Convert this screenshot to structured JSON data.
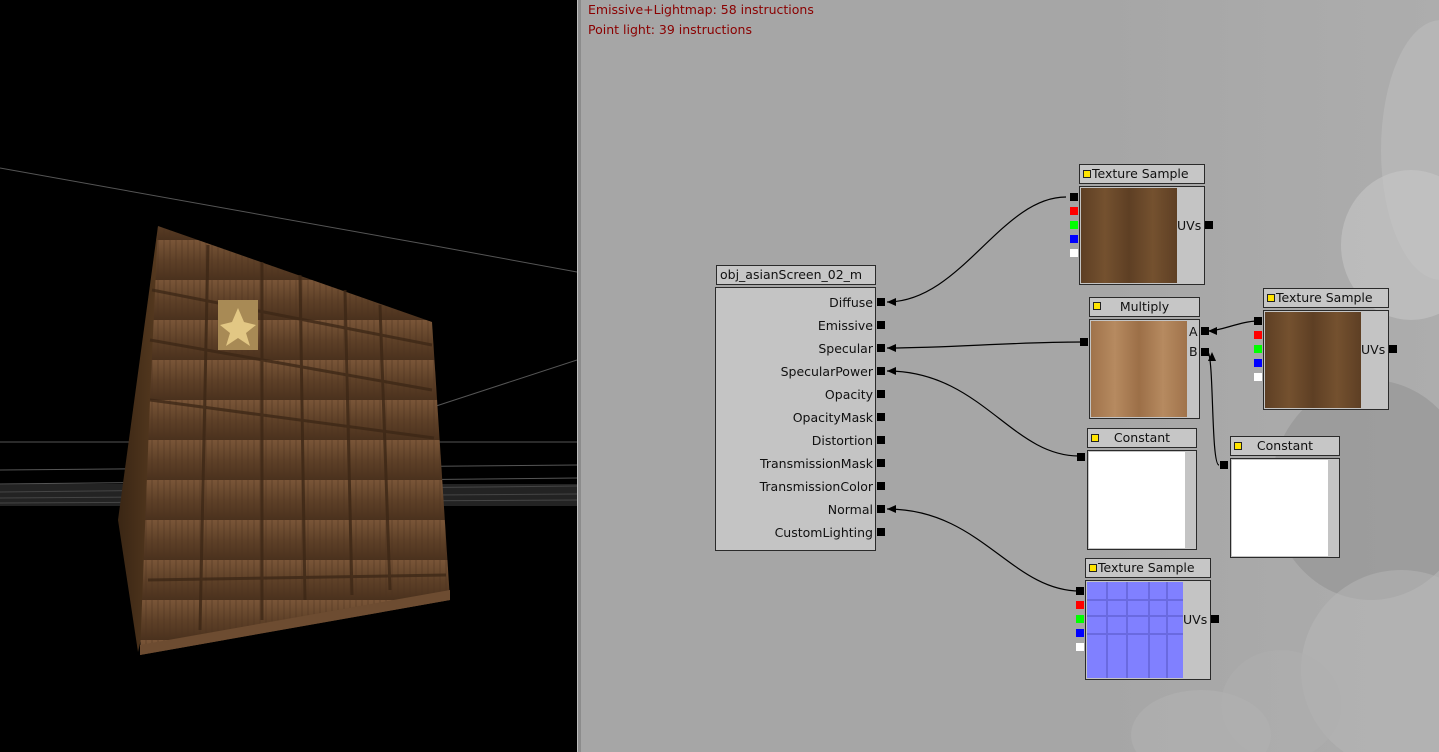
{
  "stats": {
    "line1": "Emissive+Lightmap: 58 instructions",
    "line2": "Point light: 39 instructions"
  },
  "material_node": {
    "title": "obj_asianScreen_02_m",
    "inputs": [
      "Diffuse",
      "Emissive",
      "Specular",
      "SpecularPower",
      "Opacity",
      "OpacityMask",
      "Distortion",
      "TransmissionMask",
      "TransmissionColor",
      "Normal",
      "CustomLighting"
    ]
  },
  "nodes": {
    "tex_diffuse": {
      "title": "Texture Sample",
      "uv_label": "UVs"
    },
    "multiply": {
      "title": "Multiply",
      "input_a": "A",
      "input_b": "B"
    },
    "tex_spec": {
      "title": "Texture Sample",
      "uv_label": "UVs"
    },
    "constant_1": {
      "title": "Constant"
    },
    "constant_2": {
      "title": "Constant"
    },
    "tex_normal": {
      "title": "Texture Sample",
      "uv_label": "UVs"
    }
  },
  "channel_colors": [
    "#000000",
    "#ff0000",
    "#00ff00",
    "#0000ff",
    "#ffffff"
  ],
  "colors": {
    "stats_text": "#8a0000",
    "node_bg": "#c4c4c4",
    "node_marker": "#ffe400",
    "wood": "#6b4a2e",
    "normal_map": "#8080ff"
  }
}
